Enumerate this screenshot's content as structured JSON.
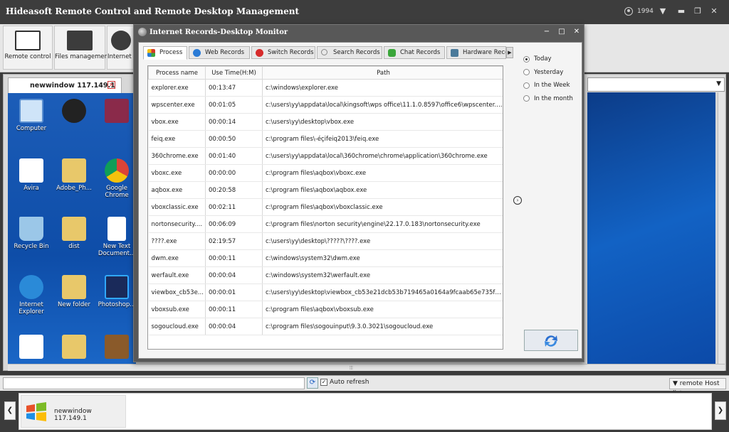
{
  "app": {
    "title": "Hideasoft Remote Control and Remote Desktop Management",
    "user": "1994"
  },
  "toolbar": {
    "remote_control": "Remote control",
    "files_management": "Files management",
    "internet_management": "Internet ma"
  },
  "desktop_tab": {
    "label": "newwindow 117.149.1"
  },
  "desktop_icons": [
    {
      "label": "Computer"
    },
    {
      "label": ""
    },
    {
      "label": ""
    },
    {
      "label": "Avira"
    },
    {
      "label": "Adobe_Ph..."
    },
    {
      "label": "Google Chrome"
    },
    {
      "label": "Recycle Bin"
    },
    {
      "label": "dist"
    },
    {
      "label": "New Text Document..."
    },
    {
      "label": "Internet Explorer"
    },
    {
      "label": "New folder"
    },
    {
      "label": "Photoshop..."
    },
    {
      "label": ""
    },
    {
      "label": ""
    },
    {
      "label": ""
    }
  ],
  "dialog": {
    "title": "Internet Records-Desktop Monitor",
    "tabs": [
      {
        "label": "Process",
        "color": "#d63a2a"
      },
      {
        "label": "Web Records",
        "color": "#2a7bd6"
      },
      {
        "label": "Switch Records",
        "color": "#d62a2a"
      },
      {
        "label": "Search Records",
        "color": "#888888"
      },
      {
        "label": "Chat Records",
        "color": "#3aa63a"
      },
      {
        "label": "Hardware Records",
        "color": "#4a7a9a"
      }
    ],
    "columns": [
      "Process name",
      "Use Time(H:M)",
      "Path"
    ],
    "rows": [
      [
        "explorer.exe",
        "00:13:47",
        "c:\\windows\\explorer.exe"
      ],
      [
        "wpscenter.exe",
        "00:01:05",
        "c:\\users\\yy\\appdata\\local\\kingsoft\\wps office\\11.1.0.8597\\office6\\wpscenter.exe"
      ],
      [
        "vbox.exe",
        "00:00:14",
        "c:\\users\\yy\\desktop\\vbox.exe"
      ],
      [
        "feiq.exe",
        "00:00:50",
        "c:\\program files\\-éçifeiq2013\\feiq.exe"
      ],
      [
        "360chrome.exe",
        "00:01:40",
        "c:\\users\\yy\\appdata\\local\\360chrome\\chrome\\application\\360chrome.exe"
      ],
      [
        "vboxc.exe",
        "00:00:00",
        "c:\\program files\\aqbox\\vboxc.exe"
      ],
      [
        "aqbox.exe",
        "00:20:58",
        "c:\\program files\\aqbox\\aqbox.exe"
      ],
      [
        "vboxclassic.exe",
        "00:02:11",
        "c:\\program files\\aqbox\\vboxclassic.exe"
      ],
      [
        "nortonsecurity....",
        "00:06:09",
        "c:\\program files\\norton security\\engine\\22.17.0.183\\nortonsecurity.exe"
      ],
      [
        "????.exe",
        "02:19:57",
        "c:\\users\\yy\\desktop\\?????\\????.exe"
      ],
      [
        "dwm.exe",
        "00:00:11",
        "c:\\windows\\system32\\dwm.exe"
      ],
      [
        "werfault.exe",
        "00:00:04",
        "c:\\windows\\system32\\werfault.exe"
      ],
      [
        "viewbox_cb53e...",
        "00:00:01",
        "c:\\users\\yy\\desktop\\viewbox_cb53e21dcb53b719465a0164a9fcaab65e735f6e0..."
      ],
      [
        "vboxsub.exe",
        "00:00:11",
        "c:\\program files\\aqbox\\vboxsub.exe"
      ],
      [
        "sogoucloud.exe",
        "00:00:04",
        "c:\\program files\\sogouinput\\9.3.0.3021\\sogoucloud.exe"
      ]
    ],
    "periods": [
      "Today",
      "Yesterday",
      "In the Week",
      "In the month"
    ],
    "selected_period": "Today"
  },
  "bottombar": {
    "auto_refresh": "Auto refresh",
    "remote_host_list": "remote Host list"
  },
  "hosts": [
    {
      "label": "newwindow 117.149.1"
    }
  ]
}
